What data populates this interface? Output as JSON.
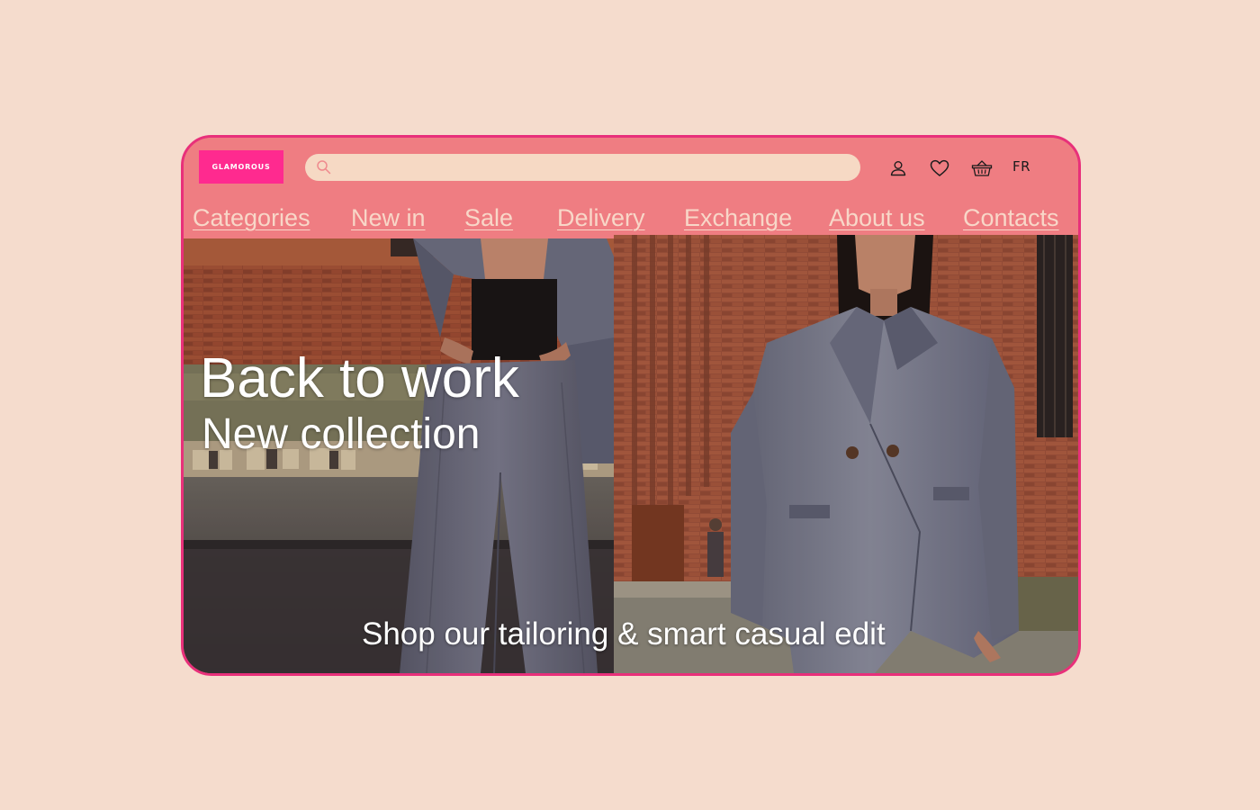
{
  "brand": {
    "logo_text": "GLAMOROUS",
    "logo_color": "#ff2a8f"
  },
  "header": {
    "search": {
      "value": "",
      "placeholder": "",
      "icon": "search-icon"
    },
    "icons": [
      "account-icon",
      "heart-icon",
      "basket-icon"
    ],
    "language": "FR"
  },
  "nav": {
    "items": [
      {
        "label": "Categories"
      },
      {
        "label": "New in"
      },
      {
        "label": "Sale"
      },
      {
        "label": "Delivery"
      },
      {
        "label": "Exchange"
      },
      {
        "label": "About us"
      },
      {
        "label": "Contacts"
      }
    ]
  },
  "hero": {
    "title": "Back to work",
    "subtitle": "New collection",
    "cta": "Shop our tailoring & smart casual edit"
  },
  "colors": {
    "page_background": "#f5dccd",
    "header_background": "#ef7d82",
    "frame_border": "#e8307a",
    "nav_text": "#f8d7c8",
    "search_background": "#f6d9c4"
  }
}
